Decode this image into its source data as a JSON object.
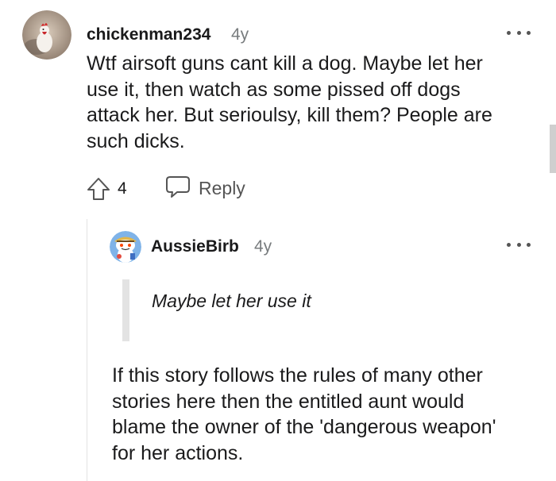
{
  "parent_comment": {
    "username": "chickenman234",
    "age": "4y",
    "body_lines": [
      "Wtf airsoft guns cant kill a dog. Maybe let her",
      "use it, then watch as some pissed off dogs",
      "attack her. But serioulsy, kill them? People are",
      "such dicks."
    ],
    "vote_count": "4",
    "reply_label": "Reply",
    "icons": {
      "avatar": "chicken-avatar",
      "more": "more-options-icon",
      "upvote": "upvote-arrow-icon",
      "reply": "speech-bubble-icon"
    }
  },
  "reply_comment": {
    "username": "AussieBirb",
    "age": "4y",
    "quote": "Maybe let her use it",
    "body_lines": [
      "If this story follows the rules of many other",
      "stories here then the entitled aunt would",
      "blame the owner of the 'dangerous weapon'",
      "for her actions."
    ],
    "icons": {
      "avatar": "snoo-avatar",
      "more": "more-options-icon"
    }
  },
  "colors": {
    "text": "#1a1a1b",
    "meta": "#787c7e",
    "thread_line": "#e3e3e3",
    "icon": "#555555"
  }
}
